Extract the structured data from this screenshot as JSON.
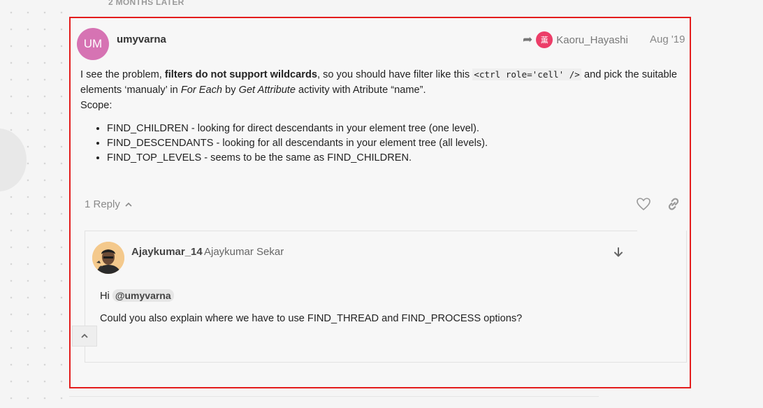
{
  "time_gap": "2 MONTHS LATER",
  "post": {
    "avatar_initials": "UM",
    "username": "umyvarna",
    "reply_to": {
      "avatar_char": "薫",
      "username": "Kaoru_Hayashi"
    },
    "date": "Aug '19",
    "body": {
      "p1_before": "I see the problem, ",
      "p1_bold": "filters do not support wildcards",
      "p1_mid": ", so you should have filter like this ",
      "p1_code": "<ctrl role='cell' />",
      "p1_after": " and pick the suitable elements ‘manualy’ in ",
      "p1_em1": "For Each",
      "p1_by": " by ",
      "p1_em2": "Get Attribute",
      "p1_end": " activity with Atribute “name”.",
      "scope": "Scope:",
      "list": [
        "FIND_CHILDREN - looking for direct descendants in your element tree (one level).",
        "FIND_DESCENDANTS - looking for all descendants in your element tree (all levels).",
        "FIND_TOP_LEVELS - seems to be the same as FIND_CHILDREN."
      ]
    },
    "replies_label": "1 Reply"
  },
  "reply": {
    "username": "Ajaykumar_14",
    "full_name": "Ajaykumar Sekar",
    "greeting": "Hi ",
    "mention": "@umyvarna",
    "text": "Could you also explain where we have to use FIND_THREAD and FIND_PROCESS options?"
  },
  "icons": {
    "share_arrow": "reply-arrow-icon",
    "like": "heart-icon",
    "link": "link-icon",
    "expand": "arrow-down-icon",
    "chevron": "chevron-up-icon",
    "scroll_top": "chevron-up-icon"
  }
}
